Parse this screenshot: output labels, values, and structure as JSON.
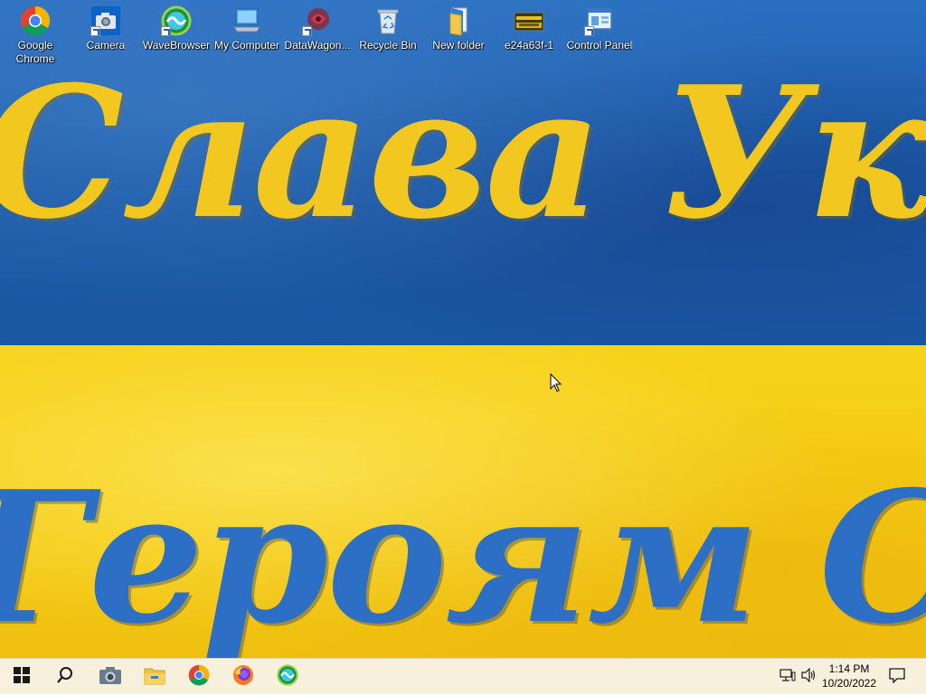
{
  "wallpaper": {
    "line1": "Слава Україні",
    "line2": "Героям Слава"
  },
  "desktop_icons": [
    {
      "label": "Google Chrome",
      "icon": "chrome-icon",
      "shortcut": false
    },
    {
      "label": "Camera",
      "icon": "camera-icon",
      "shortcut": true
    },
    {
      "label": "WaveBrowser",
      "icon": "wavebrowser-icon",
      "shortcut": true
    },
    {
      "label": "My Computer",
      "icon": "computer-icon",
      "shortcut": false
    },
    {
      "label": "DataWagon...",
      "icon": "datawagon-icon",
      "shortcut": true
    },
    {
      "label": "Recycle Bin",
      "icon": "recycle-bin-icon",
      "shortcut": false
    },
    {
      "label": "New folder",
      "icon": "folder-icon",
      "shortcut": false
    },
    {
      "label": "e24a63f-1",
      "icon": "image-file-icon",
      "shortcut": false
    },
    {
      "label": "Control Panel",
      "icon": "control-panel-icon",
      "shortcut": true
    }
  ],
  "taskbar": {
    "pinned": [
      "start-icon",
      "search-icon",
      "camera-icon",
      "file-explorer-icon",
      "chrome-icon",
      "firefox-icon",
      "wavebrowser-icon"
    ],
    "clock": {
      "time": "1:14 PM",
      "date": "10/20/2022"
    },
    "tray": [
      "network-icon",
      "volume-icon",
      "notification-icon"
    ]
  },
  "colors": {
    "flag_blue": "#1f5fb0",
    "flag_yellow": "#f5cb14",
    "taskbar_bg": "#f7f0dc"
  }
}
